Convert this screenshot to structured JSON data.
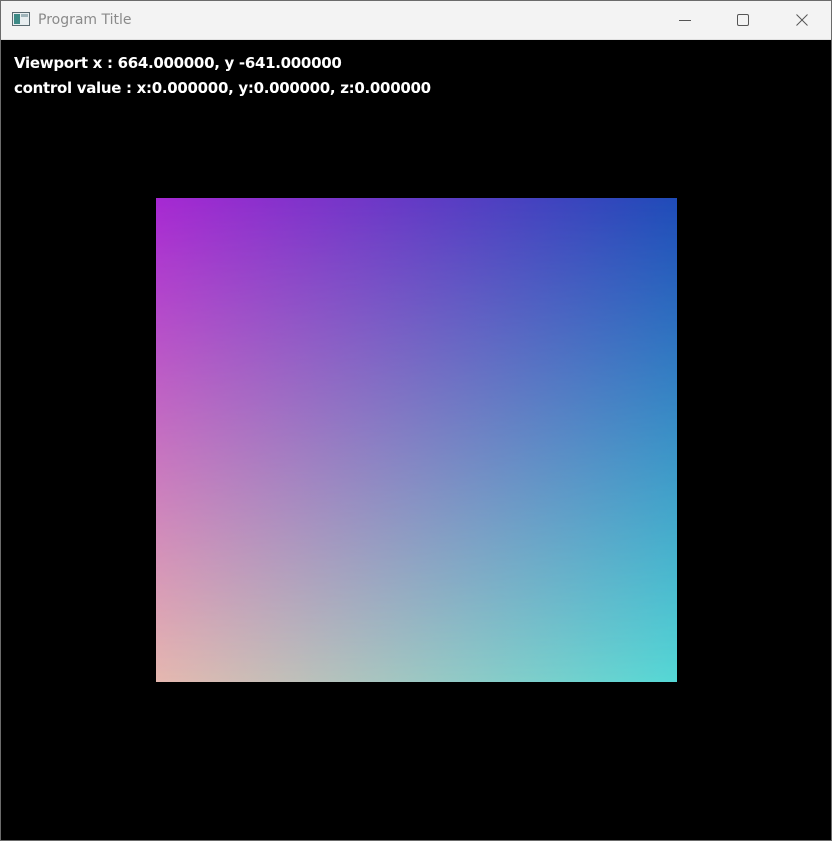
{
  "window": {
    "title": "Program Title",
    "icon": "app-window-icon",
    "controls": {
      "minimize_icon": "minimize-icon",
      "maximize_icon": "maximize-icon",
      "close_icon": "close-icon"
    }
  },
  "hud": {
    "viewport_line": "Viewport x : 664.000000, y -641.000000",
    "control_line": "control value : x:0.000000, y:0.000000, z:0.000000"
  },
  "canvas": {
    "background": "#000000",
    "quad_corner_colors": {
      "top_left": "#a628d2",
      "top_right": "#1f4bb8",
      "bottom_left": "#e6b8b0",
      "bottom_right": "#55d8d6"
    }
  }
}
